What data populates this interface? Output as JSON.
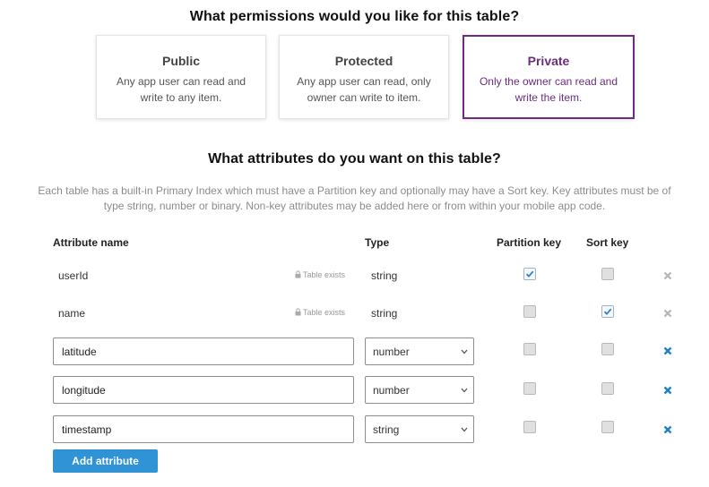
{
  "permissions": {
    "title": "What permissions would you like for this table?",
    "options": [
      {
        "label": "Public",
        "description": "Any app user can read and write to any item.",
        "selected": false
      },
      {
        "label": "Protected",
        "description": "Any app user can read, only owner can write to item.",
        "selected": false
      },
      {
        "label": "Private",
        "description": "Only the owner can read and write the item.",
        "selected": true
      }
    ],
    "selected_color": "#6b2d7f"
  },
  "attributes": {
    "title": "What attributes do you want on this table?",
    "description": "Each table has a built-in Primary Index which must have a Partition key and optionally may have a Sort key. Key attributes must be of type string, number or binary. Non-key attributes may be added here or from within your mobile app code.",
    "columns": {
      "name": "Attribute name",
      "type": "Type",
      "partition": "Partition key",
      "sort": "Sort key"
    },
    "existing_note": "Table exists",
    "rows": [
      {
        "name": "userId",
        "type": "string",
        "partition_key": true,
        "sort_key": false,
        "existing": true
      },
      {
        "name": "name",
        "type": "string",
        "partition_key": false,
        "sort_key": true,
        "existing": true
      },
      {
        "name": "latitude",
        "type": "number",
        "partition_key": false,
        "sort_key": false,
        "existing": false
      },
      {
        "name": "longitude",
        "type": "number",
        "partition_key": false,
        "sort_key": false,
        "existing": false
      },
      {
        "name": "timestamp",
        "type": "string",
        "partition_key": false,
        "sort_key": false,
        "existing": false
      }
    ],
    "add_button": "Add attribute",
    "accent_color": "#2f93d6"
  }
}
